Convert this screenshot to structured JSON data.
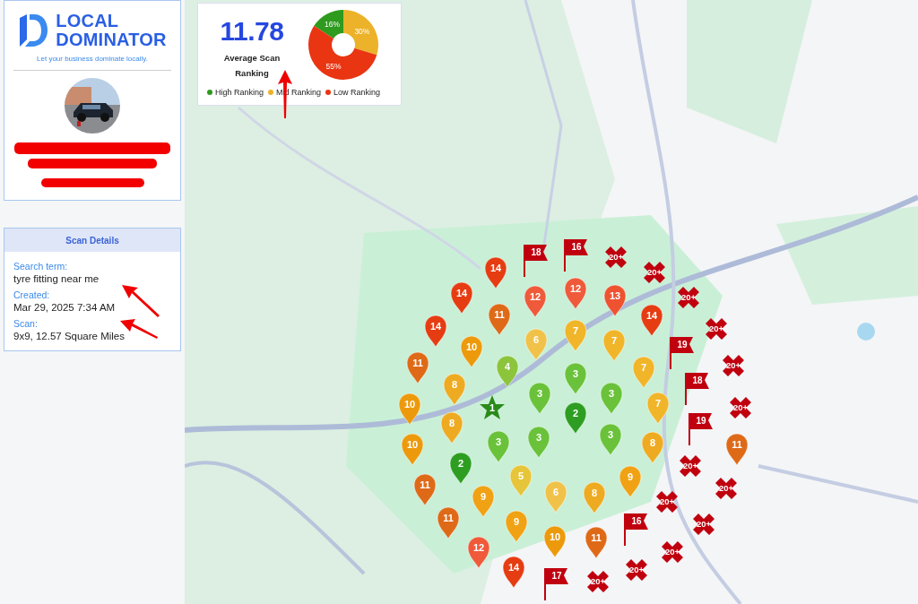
{
  "brand": {
    "line_1": "LOCAL",
    "line_2": "DOMINATOR",
    "tagline": "Let your business dominate locally."
  },
  "scan_details": {
    "title": "Scan Details",
    "fields": [
      {
        "label": "Search term:",
        "value": "tyre fitting near me"
      },
      {
        "label": "Created:",
        "value": "Mar 29, 2025 7:34 AM"
      },
      {
        "label": "Scan:",
        "value": "9x9, 12.57 Square Miles"
      }
    ]
  },
  "score": {
    "value": "11.78",
    "caption": "Average Scan Ranking",
    "chart_data": {
      "type": "donut",
      "categories": [
        "High Ranking",
        "Mid Ranking",
        "Low Ranking"
      ],
      "values": [
        16,
        30,
        55
      ],
      "value_labels": [
        "16%",
        "30%",
        "55%"
      ],
      "colors": [
        "#2e9a1e",
        "#ecb22a",
        "#e93512"
      ]
    }
  },
  "map": {
    "pins": [
      {
        "rank": "14",
        "kind": "pin",
        "color": "#e63c12"
      },
      {
        "rank": "18",
        "kind": "flag",
        "color": "#c0000f"
      },
      {
        "rank": "16",
        "kind": "flag",
        "color": "#c0000f"
      },
      {
        "rank": "20+",
        "kind": "cross",
        "color": "#c0000f"
      },
      {
        "rank": "20+",
        "kind": "cross",
        "color": "#c0000f"
      },
      {
        "rank": "14",
        "kind": "pin",
        "color": "#e63c12"
      },
      {
        "rank": "12",
        "kind": "pin",
        "color": "#ef5a3a"
      },
      {
        "rank": "12",
        "kind": "pin",
        "color": "#ef5a3a"
      },
      {
        "rank": "13",
        "kind": "pin",
        "color": "#ee5230"
      },
      {
        "rank": "14",
        "kind": "pin",
        "color": "#e63c12"
      },
      {
        "rank": "20+",
        "kind": "cross",
        "color": "#c0000f"
      },
      {
        "rank": "14",
        "kind": "pin",
        "color": "#e63c12"
      },
      {
        "rank": "11",
        "kind": "pin",
        "color": "#de6a18"
      },
      {
        "rank": "6",
        "kind": "pin",
        "color": "#f0c24a"
      },
      {
        "rank": "7",
        "kind": "pin",
        "color": "#f1b52a"
      },
      {
        "rank": "7",
        "kind": "pin",
        "color": "#f1b52a"
      },
      {
        "rank": "19",
        "kind": "flag",
        "color": "#c0000f"
      },
      {
        "rank": "20+",
        "kind": "cross",
        "color": "#c0000f"
      },
      {
        "rank": "10",
        "kind": "pin",
        "color": "#ec9a0c"
      },
      {
        "rank": "11",
        "kind": "pin",
        "color": "#de6a18"
      },
      {
        "rank": "4",
        "kind": "pin",
        "color": "#8cc43c"
      },
      {
        "rank": "3",
        "kind": "pin",
        "color": "#6ac23a"
      },
      {
        "rank": "7",
        "kind": "pin",
        "color": "#f1b52a"
      },
      {
        "rank": "20+",
        "kind": "cross",
        "color": "#c0000f"
      },
      {
        "rank": "8",
        "kind": "pin",
        "color": "#eeab22"
      },
      {
        "rank": "3",
        "kind": "pin",
        "color": "#6ac23a"
      },
      {
        "rank": "3",
        "kind": "pin",
        "color": "#6ac23a"
      },
      {
        "rank": "18",
        "kind": "flag",
        "color": "#c0000f"
      },
      {
        "rank": "7",
        "kind": "pin",
        "color": "#f1b52a"
      },
      {
        "rank": "20+",
        "kind": "cross",
        "color": "#c0000f"
      },
      {
        "rank": "10",
        "kind": "pin",
        "color": "#ec9a0c"
      },
      {
        "rank": "1",
        "kind": "star",
        "color": "#2a8a1a"
      },
      {
        "rank": "2",
        "kind": "pin",
        "color": "#2e9e22"
      },
      {
        "rank": "3",
        "kind": "pin",
        "color": "#6ac23a"
      },
      {
        "rank": "19",
        "kind": "flag",
        "color": "#c0000f"
      },
      {
        "rank": "11",
        "kind": "pin",
        "color": "#de6a18"
      },
      {
        "rank": "8",
        "kind": "pin",
        "color": "#eeab22"
      },
      {
        "rank": "3",
        "kind": "pin",
        "color": "#6ac23a"
      },
      {
        "rank": "3",
        "kind": "pin",
        "color": "#6ac23a"
      },
      {
        "rank": "8",
        "kind": "pin",
        "color": "#eeab22"
      },
      {
        "rank": "20+",
        "kind": "cross",
        "color": "#c0000f"
      },
      {
        "rank": "10",
        "kind": "pin",
        "color": "#ec9a0c"
      },
      {
        "rank": "2",
        "kind": "pin",
        "color": "#2e9e22"
      },
      {
        "rank": "5",
        "kind": "pin",
        "color": "#e7c53a"
      },
      {
        "rank": "9",
        "kind": "pin",
        "color": "#f0a214"
      },
      {
        "rank": "20+",
        "kind": "cross",
        "color": "#c0000f"
      },
      {
        "rank": "11",
        "kind": "pin",
        "color": "#de6a18"
      },
      {
        "rank": "9",
        "kind": "pin",
        "color": "#f0a214"
      },
      {
        "rank": "6",
        "kind": "pin",
        "color": "#f0c24a"
      },
      {
        "rank": "8",
        "kind": "pin",
        "color": "#eeab22"
      },
      {
        "rank": "20+",
        "kind": "cross",
        "color": "#c0000f"
      },
      {
        "rank": "20+",
        "kind": "cross",
        "color": "#c0000f"
      },
      {
        "rank": "11",
        "kind": "pin",
        "color": "#de6a18"
      },
      {
        "rank": "9",
        "kind": "pin",
        "color": "#f0a214"
      },
      {
        "rank": "10",
        "kind": "pin",
        "color": "#ec9a0c"
      },
      {
        "rank": "11",
        "kind": "pin",
        "color": "#de6a18"
      },
      {
        "rank": "16",
        "kind": "flag",
        "color": "#c0000f"
      },
      {
        "rank": "20+",
        "kind": "cross",
        "color": "#c0000f"
      },
      {
        "rank": "12",
        "kind": "pin",
        "color": "#ef5a3a"
      },
      {
        "rank": "14",
        "kind": "pin",
        "color": "#e63c12"
      },
      {
        "rank": "17",
        "kind": "flag",
        "color": "#c0000f"
      },
      {
        "rank": "20+",
        "kind": "cross",
        "color": "#c0000f"
      },
      {
        "rank": "20+",
        "kind": "cross",
        "color": "#c0000f"
      }
    ]
  }
}
